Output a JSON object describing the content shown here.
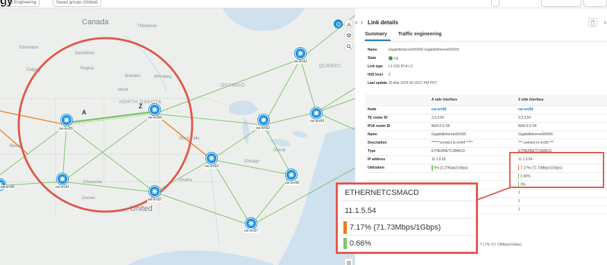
{
  "header": {
    "title": "gy",
    "chip_1": "ffic Engineering",
    "chip_2": "Saved groups (Global)"
  },
  "map": {
    "labels": {
      "canada": "Canada",
      "united": "United",
      "regina": "Regina",
      "calgary": "Calgary",
      "brandon": "Brandon",
      "winnipeg": "Winnipeg",
      "minot": "Minot",
      "north_dakota": "NORTH DAKOTA",
      "sioux_falls": "Sioux Falls",
      "cheyenne": "Cheyenne",
      "denver": "Denver",
      "omaha": "Omaha",
      "ontario": "ONTARIO",
      "detroit": "Detroit",
      "thompson": "Thompson",
      "edmonton": "Edmonton",
      "saskatoon": "Saskatoon",
      "quebec": "QUEBEC",
      "chicago": "Chicago",
      "boise": "Boise"
    },
    "link_end_a": "A",
    "link_end_z": "Z",
    "nodes": {
      "xrv61": "cw-xrv61",
      "xrv55": "cw-xrv55",
      "xrv54": "cw-xrv54",
      "xrv62": "cw-xrv62",
      "xrv59": "cw-xrv59",
      "xrv53": "cw-xrv53",
      "xrv51": "cw-xrv51",
      "xrv52": "cw-xrv52",
      "xrv58": "cw-xrv58",
      "xrv57": "cw-xrv57",
      "xrv50": "cw-xrv50"
    },
    "colors": {
      "link_green": "#7dc36b",
      "link_orange": "#f07b1c",
      "node_blue": "#1e8fd8",
      "highlight_red": "#e2574a"
    }
  },
  "panel": {
    "title": "Link details",
    "tabs": [
      "Summary",
      "Traffic engineering"
    ],
    "summary": {
      "name_label": "Name",
      "name_value": "GigabitEthernet0/0/0/5-GigabitEthernet0/0/0/5",
      "state_label": "State",
      "state_value": "Up",
      "link_type_label": "Link type",
      "link_type_value": "L3 ISIS IPv4 L2",
      "isis_level_label": "ISIS level",
      "isis_level_value": "2",
      "last_update_label": "Last update",
      "last_update_value": "25-Mar-2024 05:19:57 PM PDT"
    },
    "table": {
      "headers": [
        "",
        "A side Interface",
        "Z side Interface"
      ],
      "rows": [
        {
          "label": "Node",
          "a": "cw-xrv55",
          "z": "cw-xrv54"
        },
        {
          "label": "TE router ID",
          "a": "3.3.3.55",
          "z": "3.3.3.54"
        },
        {
          "label": "IPv6 router ID",
          "a": "fb00:3:3::55",
          "z": "fb00:3:3::54"
        },
        {
          "label": "Name",
          "a": "GigabitEthernet0/0/0/5",
          "z": "GigabitEthernet0/0/0/5"
        },
        {
          "label": "Description",
          "a": "******connect to xrv54 *****",
          "z": "*** connect to xrv55 ***"
        },
        {
          "label": "Type",
          "a": "ETHERNETCSMACD",
          "z": "ETHERNETCSMACD"
        },
        {
          "label": "IP address",
          "a": "11.1.5.55",
          "z": "11.1.5.54"
        },
        {
          "label": "Utilization",
          "a": "0% (2.27Kbps/1Gbps)",
          "z": "7.17% (71.73Mbps/1Gbps)"
        },
        {
          "label": "",
          "a": "",
          "z": "0.66%"
        },
        {
          "label": "",
          "a": "",
          "z": "0%"
        },
        {
          "label": "",
          "a": "",
          "z": "1"
        },
        {
          "label": "",
          "a": "",
          "z": "1"
        },
        {
          "label": "",
          "a": "",
          "z": "1"
        }
      ],
      "utilization_a_pct": 0,
      "utilization_z_pct": 7.17,
      "row9_z_pct": 0.66,
      "row10_z_pct": 0
    },
    "low_text": "7.17% (71.73Mbps/1Gbps)"
  },
  "zoom": {
    "type": "ETHERNETCSMACD",
    "ip": "11.1.5.54",
    "utilization": "7.17% (71.73Mbps/1Gbps)",
    "util_pct": 7.17,
    "second": "0.66%",
    "second_pct": 0.66
  }
}
